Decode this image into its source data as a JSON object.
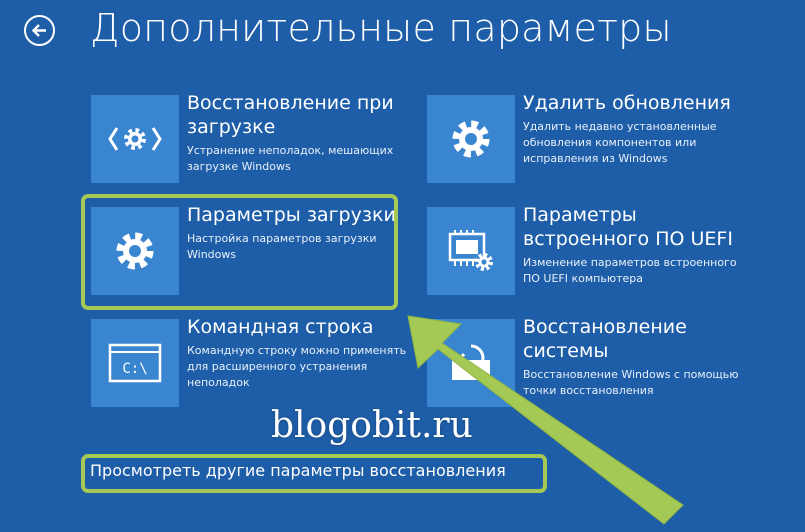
{
  "page": {
    "title": "Дополнительные параметры",
    "back_icon": "back-arrow-icon",
    "accent": "#1e5ea8",
    "highlight_color": "#a4c955"
  },
  "tiles": [
    {
      "title": "Восстановление при загрузке",
      "desc": "Устранение неполадок, мешающих загрузке Windows",
      "icon": "startup-repair-icon"
    },
    {
      "title": "Удалить обновления",
      "desc": "Удалить недавно установленные обновления компонентов или исправления из Windows",
      "icon": "gear-icon"
    },
    {
      "title": "Параметры загрузки",
      "desc": "Настройка параметров загрузки Windows",
      "icon": "gear-icon"
    },
    {
      "title": "Параметры встроенного ПО UEFI",
      "desc": "Изменение параметров встроенного ПО UEFI компьютера",
      "icon": "uefi-chip-icon"
    },
    {
      "title": "Командная строка",
      "desc": "Командную строку можно применять для расширенного устранения неполадок",
      "icon": "command-prompt-icon",
      "prompt_text": "C:\\"
    },
    {
      "title": "Восстановление системы",
      "desc": "Восстановление Windows с помощью точки восстановления",
      "icon": "system-restore-icon"
    }
  ],
  "more_link": "Просмотреть другие параметры восстановления",
  "watermark": "blogobit.ru"
}
